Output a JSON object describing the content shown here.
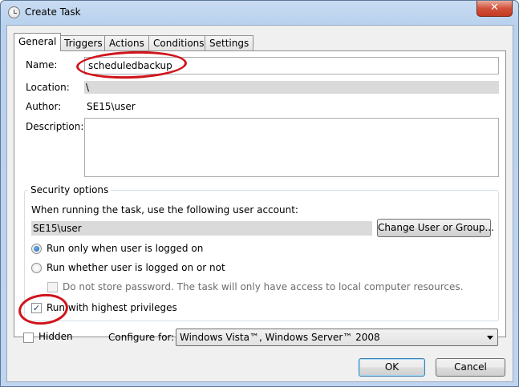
{
  "window": {
    "title": "Create Task",
    "close_glyph": "✕"
  },
  "tabs": [
    {
      "label": "General"
    },
    {
      "label": "Triggers"
    },
    {
      "label": "Actions"
    },
    {
      "label": "Conditions"
    },
    {
      "label": "Settings"
    }
  ],
  "general": {
    "name_label": "Name:",
    "name_value": "scheduledbackup",
    "location_label": "Location:",
    "location_value": "\\",
    "author_label": "Author:",
    "author_value": "SE15\\user",
    "description_label": "Description:",
    "description_value": ""
  },
  "security": {
    "group_title": "Security options",
    "account_prompt": "When running the task, use the following user account:",
    "account_value": "SE15\\user",
    "change_user_button": "Change User or Group...",
    "radio_logged_on": "Run only when user is logged on",
    "radio_logged_on_checked": true,
    "radio_whether": "Run whether user is logged on or not",
    "dont_store_password": "Do not store password.  The task will only have access to local computer resources.",
    "highest_privileges": "Run with highest privileges",
    "highest_privileges_checked": true
  },
  "bottom": {
    "hidden_label": "Hidden",
    "hidden_checked": false,
    "configure_label": "Configure for:",
    "configure_value": "Windows Vista™, Windows Server™ 2008"
  },
  "buttons": {
    "ok": "OK",
    "cancel": "Cancel"
  },
  "colors": {
    "annotation": "#d0141b",
    "accent": "#1c5fa8"
  }
}
